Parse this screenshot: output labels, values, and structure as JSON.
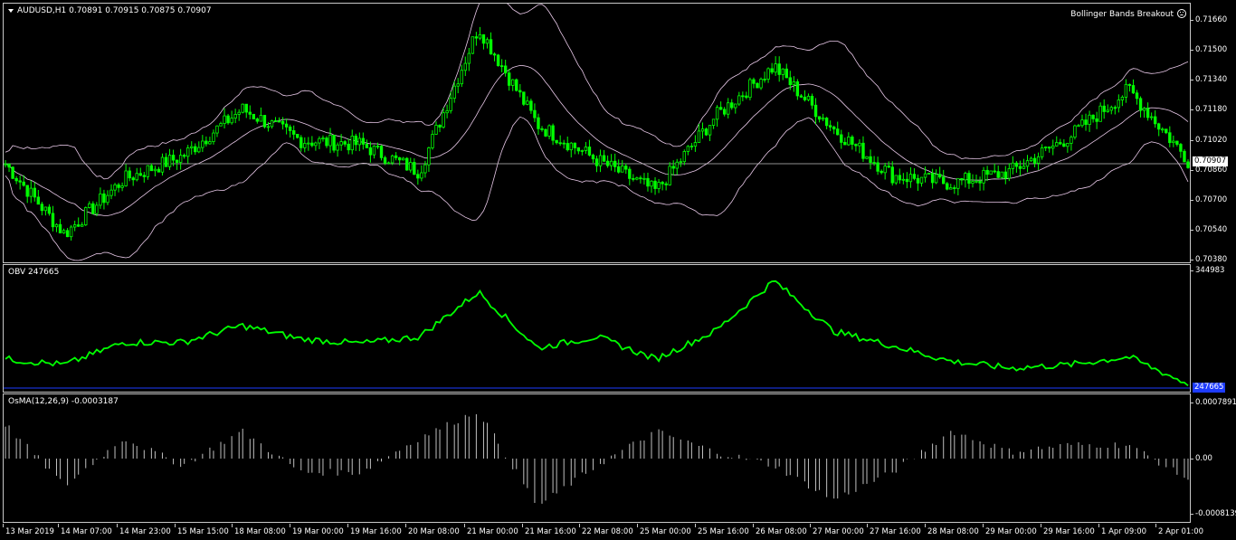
{
  "main": {
    "symbol_info": "AUDUSD,H1  0.70891 0.70915 0.70875 0.70907",
    "indicator_name": "Bollinger Bands Breakout",
    "price_levels": [
      "0.71660",
      "0.71500",
      "0.71340",
      "0.71180",
      "0.71020",
      "0.70860",
      "0.70700",
      "0.70540",
      "0.70380"
    ],
    "current_price": "0.70907",
    "colors": {
      "candles": "#00ff00",
      "bands": "#e8c8e8",
      "price_line": "#c0c0c0",
      "tag_bg": "#ffffff"
    }
  },
  "obv": {
    "label": "OBV 247665",
    "top_value": "344983",
    "current_tag": "247665",
    "colors": {
      "line": "#00ff00",
      "level": "#1e3cff",
      "tag_bg": "#1e3cff"
    }
  },
  "osma": {
    "label": "OsMA(12,26,9) -0.0003187",
    "levels": [
      "0.0007891",
      "0.00",
      "-0.0008139"
    ],
    "colors": {
      "bars": "#c0c0c0"
    }
  },
  "time_axis": [
    "13 Mar 2019",
    "14 Mar 07:00",
    "14 Mar 23:00",
    "15 Mar 15:00",
    "18 Mar 08:00",
    "19 Mar 00:00",
    "19 Mar 16:00",
    "20 Mar 08:00",
    "21 Mar 00:00",
    "21 Mar 16:00",
    "22 Mar 08:00",
    "25 Mar 00:00",
    "25 Mar 16:00",
    "26 Mar 08:00",
    "27 Mar 00:00",
    "27 Mar 16:00",
    "28 Mar 08:00",
    "29 Mar 00:00",
    "29 Mar 16:00",
    "1 Apr 09:00",
    "2 Apr 01:00"
  ],
  "chart_data": {
    "type": "line",
    "title": "AUDUSD,H1",
    "ylim": [
      0.7038,
      0.717
    ],
    "x": [
      "13 Mar 2019",
      "14 Mar 07:00",
      "14 Mar 23:00",
      "15 Mar 15:00",
      "18 Mar 08:00",
      "19 Mar 00:00",
      "19 Mar 16:00",
      "20 Mar 08:00",
      "21 Mar 00:00",
      "21 Mar 16:00",
      "22 Mar 08:00",
      "25 Mar 00:00",
      "25 Mar 16:00",
      "26 Mar 08:00",
      "27 Mar 00:00",
      "27 Mar 16:00",
      "28 Mar 08:00",
      "29 Mar 00:00",
      "29 Mar 16:00",
      "1 Apr 09:00",
      "2 Apr 01:00"
    ],
    "series": [
      {
        "name": "AUDUSD,H1",
        "values": [
          0.7088,
          0.7052,
          0.708,
          0.7092,
          0.7116,
          0.71,
          0.7098,
          0.7084,
          0.7158,
          0.7108,
          0.709,
          0.7074,
          0.7112,
          0.7138,
          0.7106,
          0.7082,
          0.7078,
          0.7084,
          0.7102,
          0.7126,
          0.709
        ]
      },
      {
        "name": "OBV",
        "values": [
          270000,
          265000,
          285000,
          285000,
          300000,
          288000,
          284000,
          290000,
          330000,
          280000,
          290000,
          270000,
          295000,
          340000,
          295000,
          282000,
          268000,
          262000,
          265000,
          272000,
          247665
        ]
      },
      {
        "name": "OsMA(12,26,9)",
        "values": [
          0.0005,
          -0.0004,
          0.0003,
          -0.0001,
          0.0004,
          -0.0002,
          -0.0002,
          0.0003,
          0.0007,
          -0.0007,
          -0.0001,
          0.0004,
          0.0001,
          -0.0001,
          -0.0006,
          -0.0002,
          0.0004,
          0.0001,
          0.0002,
          0.0002,
          -0.0003
        ]
      }
    ]
  }
}
